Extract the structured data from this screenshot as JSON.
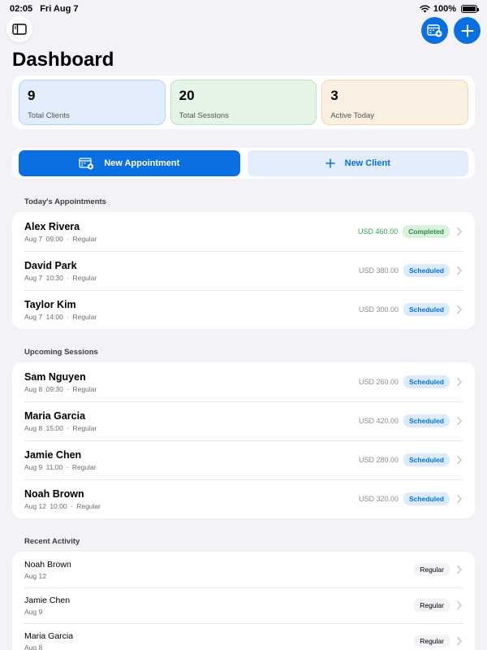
{
  "status_bar": {
    "time": "02:05",
    "date": "Fri Aug 7",
    "battery": "100%",
    "battery_level": 1.0
  },
  "header": {
    "title": "Dashboard"
  },
  "stats": [
    {
      "value": "9",
      "label": "Total Clients"
    },
    {
      "value": "20",
      "label": "Total Sessions"
    },
    {
      "value": "3",
      "label": "Active Today"
    }
  ],
  "actions": {
    "new_appointment": "New Appointment",
    "new_client": "New Client"
  },
  "sections": {
    "today": "Today's Appointments",
    "upcoming": "Upcoming Sessions",
    "recent": "Recent Activity"
  },
  "today": [
    {
      "name": "Alex Rivera",
      "date": "Aug 7",
      "time": "09:00",
      "sep": "·",
      "type": "Regular",
      "amount": "USD 460.00",
      "status": "Completed"
    },
    {
      "name": "David Park",
      "date": "Aug 7",
      "time": "10:30",
      "sep": "·",
      "type": "Regular",
      "amount": "USD 380.00",
      "status": "Scheduled"
    },
    {
      "name": "Taylor Kim",
      "date": "Aug 7",
      "time": "14:00",
      "sep": "·",
      "type": "Regular",
      "amount": "USD 300.00",
      "status": "Scheduled"
    }
  ],
  "upcoming": [
    {
      "name": "Sam Nguyen",
      "date": "Aug 8",
      "time": "09:30",
      "sep": "·",
      "type": "Regular",
      "amount": "USD 260.00",
      "status": "Scheduled"
    },
    {
      "name": "Maria Garcia",
      "date": "Aug 8",
      "time": "15:00",
      "sep": "·",
      "type": "Regular",
      "amount": "USD 420.00",
      "status": "Scheduled"
    },
    {
      "name": "Jamie Chen",
      "date": "Aug 9",
      "time": "11:00",
      "sep": "·",
      "type": "Regular",
      "amount": "USD 280.00",
      "status": "Scheduled"
    },
    {
      "name": "Noah Brown",
      "date": "Aug 12",
      "time": "10:00",
      "sep": "·",
      "type": "Regular",
      "amount": "USD 320.00",
      "status": "Scheduled"
    }
  ],
  "recent": [
    {
      "name": "Noah Brown",
      "date": "Aug 12",
      "type": "Regular"
    },
    {
      "name": "Jamie Chen",
      "date": "Aug 9",
      "type": "Regular"
    },
    {
      "name": "Maria Garcia",
      "date": "Aug 8",
      "type": "Regular"
    }
  ],
  "colors": {
    "accent": "#0a6fe0",
    "completed": "#34a853",
    "background": "#f2f2f7"
  },
  "icons": {
    "sidebar": "sidebar-icon",
    "calendar_add": "calendar-add-icon",
    "add": "plus-icon",
    "chevron": "chevron-right-icon",
    "wifi": "wifi-icon",
    "battery": "battery-icon"
  }
}
